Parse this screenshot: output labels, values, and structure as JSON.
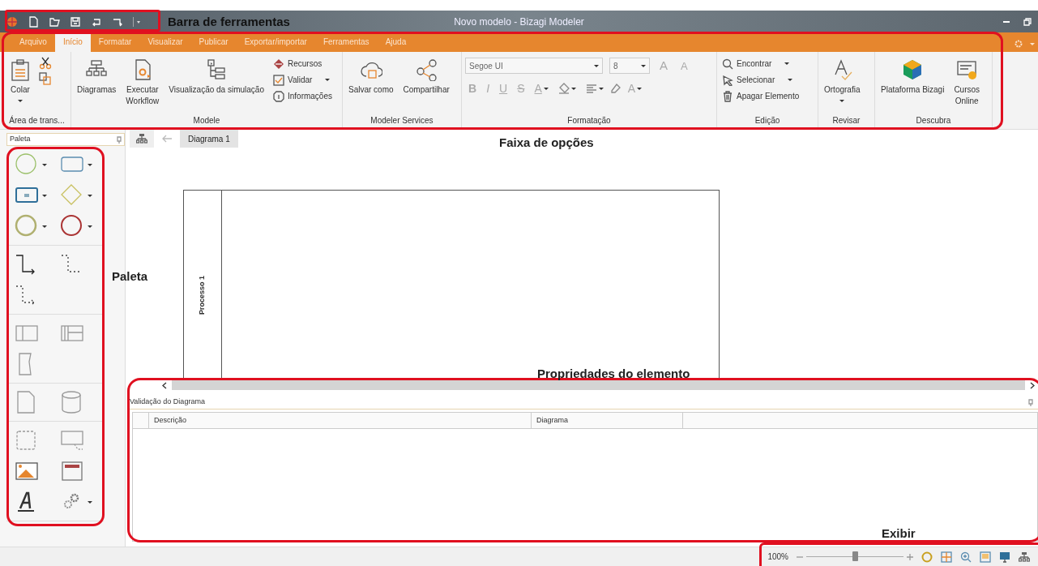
{
  "title_bar": {
    "title": "Novo modelo - Bizagi Modeler"
  },
  "menu_tabs": [
    {
      "label": "Arquivo",
      "selected": false
    },
    {
      "label": "Início",
      "selected": true
    },
    {
      "label": "Formatar",
      "selected": false
    },
    {
      "label": "Visualizar",
      "selected": false
    },
    {
      "label": "Publicar",
      "selected": false
    },
    {
      "label": "Exportar/importar",
      "selected": false
    },
    {
      "label": "Ferramentas",
      "selected": false
    },
    {
      "label": "Ajuda",
      "selected": false
    }
  ],
  "ribbon": {
    "groups": [
      {
        "label": "Área de trans...",
        "items": [
          {
            "kind": "large",
            "label": "Colar",
            "dropdown": true
          },
          {
            "kind": "icon_stack"
          }
        ]
      },
      {
        "label": "Modele",
        "items": [
          {
            "kind": "large",
            "label": "Diagramas",
            "dropdown": false
          },
          {
            "kind": "large",
            "label": "Executar\nWorkflow",
            "dropdown": false
          },
          {
            "kind": "large",
            "label": "Visualização da simulação",
            "dropdown": false
          },
          {
            "kind": "stack",
            "entries": [
              {
                "label": "Recursos",
                "dropdown": false
              },
              {
                "label": "Validar",
                "dropdown": true
              },
              {
                "label": "Informações",
                "dropdown": false
              }
            ]
          }
        ]
      },
      {
        "label": "Modeler Services",
        "items": [
          {
            "kind": "large",
            "label": "Salvar como",
            "dropdown": false
          },
          {
            "kind": "large",
            "label": "Compartilhar",
            "dropdown": false
          }
        ]
      },
      {
        "label": "Formatação",
        "items": [
          {
            "kind": "font",
            "font": "Segoe UI",
            "size": "8",
            "disabled": true,
            "size_buttons": [
              "A",
              "A"
            ],
            "style_buttons": [
              "B",
              "I",
              "U",
              "S"
            ],
            "color_button": "A",
            "effects_button": "A"
          }
        ]
      },
      {
        "label": "Edição",
        "items": [
          {
            "kind": "stack",
            "entries": [
              {
                "label": "Encontrar",
                "dropdown": true
              },
              {
                "label": "Selecionar",
                "dropdown": true
              },
              {
                "label": "Apagar Elemento",
                "dropdown": false
              }
            ]
          }
        ]
      },
      {
        "label": "Revisar",
        "items": [
          {
            "kind": "large",
            "label": "Ortografia",
            "dropdown": true
          }
        ]
      },
      {
        "label": "Descubra",
        "items": [
          {
            "kind": "large",
            "label": "Plataforma Bizagi",
            "dropdown": false
          },
          {
            "kind": "large",
            "label": "Cursos\nOnline",
            "dropdown": false
          }
        ]
      }
    ]
  },
  "palette": {
    "title": "Paleta"
  },
  "diagram_tabs": [
    {
      "label": "Diagrama 1",
      "selected": true
    }
  ],
  "pool": {
    "lane_label": "Processo 1"
  },
  "validation": {
    "title": "Validação do Diagrama",
    "columns": [
      "Descrição",
      "Diagrama"
    ]
  },
  "status_bar": {
    "zoom": "100%",
    "level": 0.5
  },
  "annotations": [
    {
      "label": "Barra de ferramentas"
    },
    {
      "label": "Faixa de opções"
    },
    {
      "label": "Paleta"
    },
    {
      "label": "Propriedades do elemento"
    },
    {
      "label": "Exibir"
    }
  ]
}
